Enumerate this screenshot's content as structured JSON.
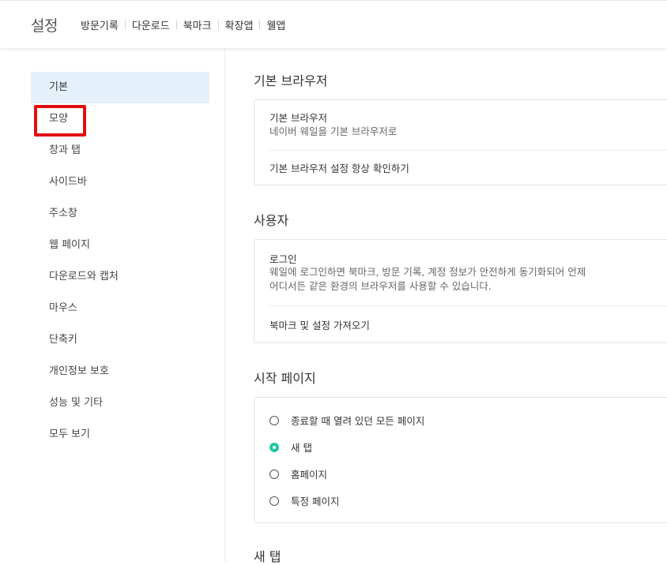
{
  "header": {
    "title": "설정",
    "nav": [
      "방문기록",
      "다운로드",
      "북마크",
      "확장앱",
      "웰앱"
    ]
  },
  "sidebar": {
    "items": [
      {
        "label": "기본",
        "active": true
      },
      {
        "label": "모양",
        "active": false
      },
      {
        "label": "창과 탭",
        "active": false
      },
      {
        "label": "사이드바",
        "active": false
      },
      {
        "label": "주소창",
        "active": false
      },
      {
        "label": "웹 페이지",
        "active": false
      },
      {
        "label": "다운로드와 캡처",
        "active": false
      },
      {
        "label": "마우스",
        "active": false
      },
      {
        "label": "단축키",
        "active": false
      },
      {
        "label": "개인정보 보호",
        "active": false
      },
      {
        "label": "성능 및 기타",
        "active": false
      },
      {
        "label": "모두 보기",
        "active": false
      }
    ]
  },
  "main": {
    "default_browser": {
      "title": "기본 브라우저",
      "row_title": "기본 브라우저",
      "row_desc": "네이버 웨일을 기본 브라우저로",
      "check_option": "기본 브라우저 설정 항상 확인하기"
    },
    "user": {
      "title": "사용자",
      "login_title": "로그인",
      "login_desc_1": "웨일에 로그인하면 북마크, 방문 기록, 계정 정보가 안전하게 동기화되어 언제",
      "login_desc_2": "어디서든 같은 환경의 브라우저를 사용할 수 있습니다.",
      "import_label": "북마크 및 설정 가져오기"
    },
    "start_page": {
      "title": "시작 페이지",
      "options": [
        {
          "label": "종료할 때 열려 있던 모든 페이지",
          "checked": false
        },
        {
          "label": "새 탭",
          "checked": true
        },
        {
          "label": "홈페이지",
          "checked": false
        },
        {
          "label": "특정 페이지",
          "checked": false
        }
      ]
    },
    "new_tab": {
      "title": "새 탭"
    }
  },
  "colors": {
    "accent": "#1ec8a5",
    "active_bg": "#e4f0fa",
    "highlight": "#e20e0e"
  }
}
